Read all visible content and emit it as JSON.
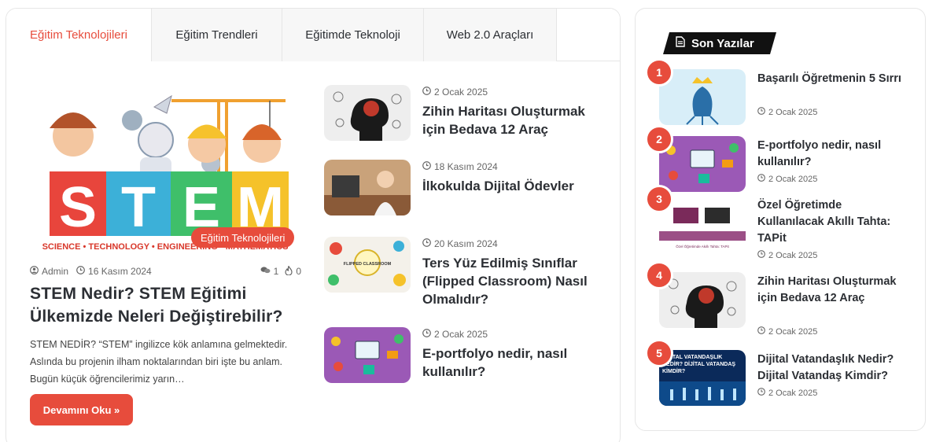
{
  "tabs": [
    {
      "label": "Eğitim Teknolojileri",
      "active": true
    },
    {
      "label": "Eğitim Trendleri",
      "active": false
    },
    {
      "label": "Eğitimde Teknoloji",
      "active": false
    },
    {
      "label": "Web 2.0 Araçları",
      "active": false
    }
  ],
  "featured": {
    "image_text": "STEM",
    "image_caption": "SCIENCE • TECHNOLOGY • ENGINEERING • MATHEMATICS",
    "category": "Eğitim Teknolojileri",
    "author": "Admin",
    "date": "16 Kasım 2024",
    "comments": "1",
    "views": "0",
    "title": "STEM Nedir? STEM Eğitimi Ülkemizde Neleri Değiştirebilir?",
    "excerpt": "STEM NEDİR?  “STEM” ingilizce kök anlamına gelmektedir. Aslında bu projenin ilham noktalarından biri işte bu anlam. Bugün küçük öğrencilerimiz yarın…",
    "read_more": "Devamını Oku »"
  },
  "posts": [
    {
      "date": "2 Ocak 2025",
      "title": "Zihin Haritası Oluşturmak için Bedava 12 Araç"
    },
    {
      "date": "18 Kasım 2024",
      "title": "İlkokulda Dijital Ödevler"
    },
    {
      "date": "20 Kasım 2024",
      "title": "Ters Yüz Edilmiş Sınıflar (Flipped Classroom) Nasıl Olmalıdır?",
      "thumb_label": "FLIPPED CLASSROOM"
    },
    {
      "date": "2 Ocak 2025",
      "title": "E-portfolyo nedir, nasıl kullanılır?"
    }
  ],
  "sidebar": {
    "heading": "Son Yazılar",
    "items": [
      {
        "num": "1",
        "title": "Başarılı Öğretmenin 5 Sırrı",
        "date": "2 Ocak 2025"
      },
      {
        "num": "2",
        "title": "E-portfolyo nedir, nasıl kullanılır?",
        "date": "2 Ocak 2025"
      },
      {
        "num": "3",
        "title": "Özel Öğretimde Kullanılacak Akıllı Tahta: TAPit",
        "date": "2 Ocak 2025",
        "thumb_label": "Özel Öğretimde Akıllı Tahta: TAPit"
      },
      {
        "num": "4",
        "title": "Zihin Haritası Oluşturmak için Bedava 12 Araç",
        "date": "2 Ocak 2025"
      },
      {
        "num": "5",
        "title": "Dijital Vatandaşlık Nedir? Dijital Vatandaş Kimdir?",
        "date": "2 Ocak 2025",
        "thumb_label": "DİJİTAL VATANDAŞLIK NEDİR? DİJİTAL VATANDAŞ KİMDİR?"
      }
    ]
  },
  "icons": {
    "user": "user-icon",
    "clock": "clock-icon",
    "comment": "comment-icon",
    "fire": "fire-icon",
    "document": "document-icon"
  },
  "colors": {
    "accent": "#e74c3c",
    "heading_bg": "#111111",
    "text": "#2c2f34"
  }
}
